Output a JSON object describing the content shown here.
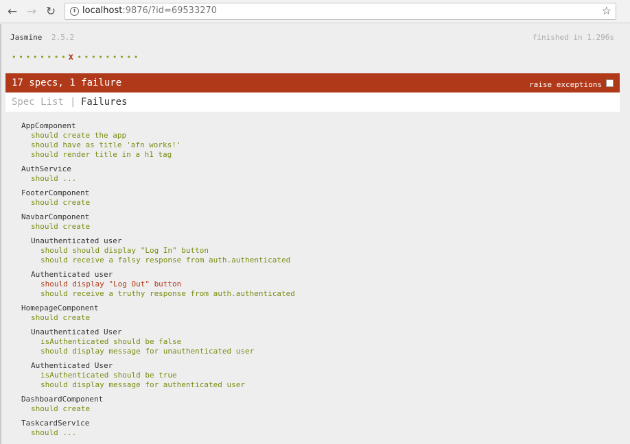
{
  "browser": {
    "url_host": "localhost",
    "url_rest": ":9876/?id=69533270"
  },
  "banner": {
    "title": "Jasmine",
    "version": "2.5.2",
    "duration": "finished in 1.296s"
  },
  "symbol_summary": [
    "passed",
    "passed",
    "passed",
    "passed",
    "passed",
    "passed",
    "passed",
    "passed",
    "passed",
    "passed",
    "passed",
    "passed",
    "passed",
    "passed",
    "passed",
    "passed",
    "passed"
  ],
  "failure_symbol_index": 8,
  "failure_symbol_char": "x",
  "passed_symbol_char": "•",
  "alert": {
    "summary": "17 specs, 1 failure",
    "raise_exceptions_label": "raise exceptions"
  },
  "menu": {
    "spec_list": "Spec List",
    "separator": "|",
    "failures": "Failures"
  },
  "colors": {
    "passed": "#7c8b12",
    "failed": "#b0391a",
    "alert_bg": "#b0391a"
  },
  "specs": {
    "app": {
      "name": "AppComponent",
      "s1": "should create the app",
      "s2": "should have as title 'afn works!'",
      "s3": "should render title in a h1 tag"
    },
    "auth": {
      "name": "AuthService",
      "s1": "should ..."
    },
    "footer": {
      "name": "FooterComponent",
      "s1": "should create"
    },
    "navbar": {
      "name": "NavbarComponent",
      "s1": "should create",
      "unauth": {
        "name": "Unauthenticated user",
        "s1": "should should display \"Log In\" button",
        "s2": "should receive a falsy response from auth.authenticated"
      },
      "auth": {
        "name": "Authenticated user",
        "s1": "should display \"Log Out\" button",
        "s2": "should receive a truthy response from auth.authenticated"
      }
    },
    "homepage": {
      "name": "HomepageComponent",
      "s1": "should create",
      "unauth": {
        "name": "Unauthenticated User",
        "s1": "isAuthenticated should be false",
        "s2": "should display message for unauthenticated user"
      },
      "auth": {
        "name": "Authenticated User",
        "s1": "isAuthenticated should be true",
        "s2": "should display message for authenticated user"
      }
    },
    "dashboard": {
      "name": "DashboardComponent",
      "s1": "should create"
    },
    "taskcard": {
      "name": "TaskcardService",
      "s1": "should ..."
    }
  }
}
